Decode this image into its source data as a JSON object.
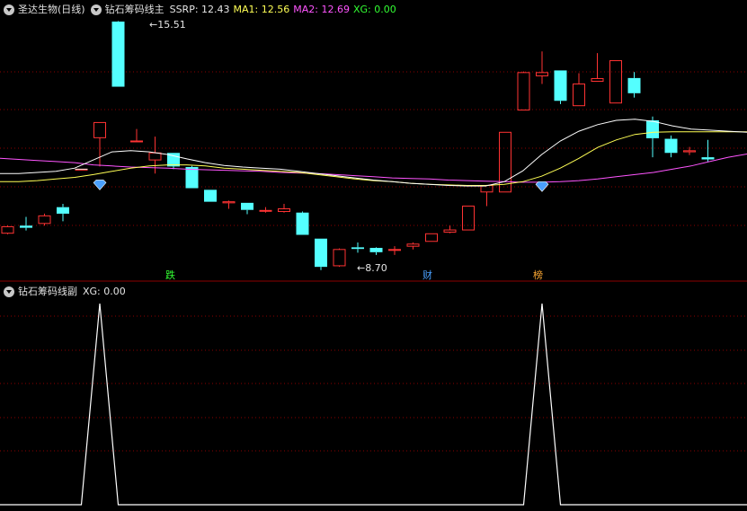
{
  "main_header": {
    "stock_name": "圣达生物(日线)",
    "indicator_name": "钻石筹码线主",
    "ssrp_label": "SSRP: 12.43",
    "ma1_label": "MA1: 12.56",
    "ma2_label": "MA2: 12.69",
    "xg_label": "XG: 0.00"
  },
  "sub_header": {
    "indicator_name": "钻石筹码线副",
    "xg_label": "XG: 0.00"
  },
  "annotations": {
    "high_label": "15.51",
    "low_label": "8.70",
    "marker_1": "跌",
    "marker_2": "财",
    "marker_3": "榜"
  },
  "colors": {
    "up": "#ff3333",
    "down": "#54ffff",
    "ma1": "#ffff55",
    "ma2": "#ff55ff",
    "ssrp": "#ffffff",
    "grid": "#8b0000",
    "diamond": "#4aa0ff",
    "xg": "#ffffff"
  },
  "chart_data": [
    {
      "type": "candlestick",
      "series": [
        "SSRP",
        "MA1",
        "MA2"
      ],
      "candles": [
        {
          "o": 11.6,
          "c": 11.72,
          "h": 11.74,
          "l": 11.58
        },
        {
          "o": 11.74,
          "c": 11.7,
          "h": 11.9,
          "l": 11.65
        },
        {
          "o": 11.78,
          "c": 11.92,
          "h": 11.96,
          "l": 11.74
        },
        {
          "o": 12.08,
          "c": 11.96,
          "h": 12.14,
          "l": 11.82
        },
        {
          "o": 12.78,
          "c": 12.78,
          "h": 12.78,
          "l": 12.78
        },
        {
          "o": 13.36,
          "c": 13.64,
          "h": 13.64,
          "l": 12.83
        },
        {
          "o": 15.5,
          "c": 14.3,
          "h": 15.51,
          "l": 14.3
        },
        {
          "o": 13.3,
          "c": 13.3,
          "h": 13.52,
          "l": 13.3
        },
        {
          "o": 12.95,
          "c": 13.08,
          "h": 13.38,
          "l": 12.7
        },
        {
          "o": 13.08,
          "c": 12.83,
          "h": 13.08,
          "l": 12.78
        },
        {
          "o": 12.82,
          "c": 12.43,
          "h": 12.84,
          "l": 12.43
        },
        {
          "o": 12.4,
          "c": 12.18,
          "h": 12.4,
          "l": 12.18
        },
        {
          "o": 12.16,
          "c": 12.18,
          "h": 12.2,
          "l": 12.05
        },
        {
          "o": 12.16,
          "c": 12.03,
          "h": 12.16,
          "l": 11.95
        },
        {
          "o": 12.02,
          "c": 12.02,
          "h": 12.08,
          "l": 11.98
        },
        {
          "o": 12.0,
          "c": 12.05,
          "h": 12.14,
          "l": 11.98
        },
        {
          "o": 11.98,
          "c": 11.57,
          "h": 12.0,
          "l": 11.57
        },
        {
          "o": 11.5,
          "c": 10.98,
          "h": 11.5,
          "l": 10.92
        },
        {
          "o": 11.0,
          "c": 11.3,
          "h": 11.32,
          "l": 10.98
        },
        {
          "o": 11.34,
          "c": 11.31,
          "h": 11.43,
          "l": 11.24
        },
        {
          "o": 11.33,
          "c": 11.25,
          "h": 11.34,
          "l": 11.2
        },
        {
          "o": 11.3,
          "c": 11.3,
          "h": 11.36,
          "l": 11.2
        },
        {
          "o": 11.36,
          "c": 11.4,
          "h": 11.43,
          "l": 11.3
        },
        {
          "o": 11.45,
          "c": 11.59,
          "h": 11.59,
          "l": 11.45
        },
        {
          "o": 11.62,
          "c": 11.66,
          "h": 11.74,
          "l": 11.6
        },
        {
          "o": 11.66,
          "c": 12.1,
          "h": 12.1,
          "l": 11.66
        },
        {
          "o": 12.36,
          "c": 12.48,
          "h": 12.48,
          "l": 12.1
        },
        {
          "o": 12.36,
          "c": 13.46,
          "h": 13.46,
          "l": 12.36
        },
        {
          "o": 13.87,
          "c": 14.56,
          "h": 14.58,
          "l": 13.87
        },
        {
          "o": 14.5,
          "c": 14.56,
          "h": 14.95,
          "l": 14.35
        },
        {
          "o": 14.6,
          "c": 14.04,
          "h": 14.6,
          "l": 13.98
        },
        {
          "o": 13.95,
          "c": 14.35,
          "h": 14.55,
          "l": 13.95
        },
        {
          "o": 14.4,
          "c": 14.45,
          "h": 14.92,
          "l": 14.4
        },
        {
          "o": 14.0,
          "c": 14.78,
          "h": 14.78,
          "l": 14.0
        },
        {
          "o": 14.46,
          "c": 14.18,
          "h": 14.57,
          "l": 14.1
        },
        {
          "o": 13.68,
          "c": 13.35,
          "h": 13.75,
          "l": 13.0
        },
        {
          "o": 13.34,
          "c": 13.08,
          "h": 13.4,
          "l": 13.0
        },
        {
          "o": 13.1,
          "c": 13.12,
          "h": 13.19,
          "l": 13.04
        },
        {
          "o": 13.0,
          "c": 12.96,
          "h": 13.32,
          "l": 12.92
        }
      ],
      "ssrp": [
        12.7,
        12.7,
        12.72,
        12.74,
        12.8,
        12.95,
        13.1,
        13.12,
        13.1,
        13.05,
        12.97,
        12.9,
        12.85,
        12.82,
        12.8,
        12.78,
        12.74,
        12.7,
        12.66,
        12.62,
        12.58,
        12.55,
        12.52,
        12.5,
        12.48,
        12.47,
        12.47,
        12.55,
        12.75,
        13.05,
        13.3,
        13.48,
        13.6,
        13.68,
        13.7,
        13.66,
        13.58,
        13.52,
        13.5,
        13.48,
        13.46
      ],
      "ma1": [
        12.55,
        12.55,
        12.57,
        12.6,
        12.63,
        12.68,
        12.74,
        12.8,
        12.84,
        12.86,
        12.86,
        12.84,
        12.8,
        12.78,
        12.76,
        12.74,
        12.72,
        12.68,
        12.64,
        12.6,
        12.57,
        12.55,
        12.52,
        12.5,
        12.49,
        12.48,
        12.48,
        12.5,
        12.55,
        12.65,
        12.8,
        12.98,
        13.18,
        13.32,
        13.42,
        13.46,
        13.47,
        13.47,
        13.47,
        13.47,
        13.47
      ],
      "ma2": [
        12.98,
        12.96,
        12.94,
        12.92,
        12.9,
        12.86,
        12.84,
        12.82,
        12.81,
        12.8,
        12.78,
        12.77,
        12.76,
        12.75,
        12.74,
        12.72,
        12.71,
        12.7,
        12.68,
        12.66,
        12.64,
        12.62,
        12.61,
        12.6,
        12.58,
        12.57,
        12.56,
        12.55,
        12.54,
        12.54,
        12.55,
        12.57,
        12.6,
        12.64,
        12.68,
        12.72,
        12.78,
        12.84,
        12.92,
        13.0,
        13.06
      ],
      "diamonds_at": [
        5,
        29
      ],
      "markers": [
        {
          "index": 9,
          "text": "跌",
          "color": "#33ff33"
        },
        {
          "index": 23,
          "text": "财",
          "color": "#4aa0ff"
        },
        {
          "index": 29,
          "text": "榜",
          "color": "#ffaa33"
        }
      ],
      "high_index": 8,
      "low_index": 19
    },
    {
      "type": "line",
      "series": [
        "XG"
      ],
      "ylim": [
        0,
        1
      ],
      "peaks": [
        5,
        29
      ]
    }
  ]
}
